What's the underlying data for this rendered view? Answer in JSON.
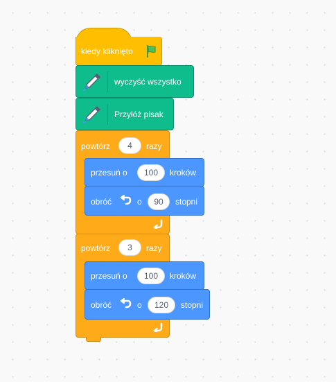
{
  "script": {
    "hat": {
      "label": "kiedy kliknięto",
      "icon": "green-flag-icon"
    },
    "clear_all": {
      "label": "wyczyść wszystko",
      "icon": "pen-icon"
    },
    "pen_down": {
      "label": "Przyłóż pisak",
      "icon": "pen-icon"
    },
    "repeat_1": {
      "label_before": "powtórz",
      "count": "4",
      "label_after": "razy",
      "move": {
        "label_before": "przesuń o",
        "value": "100",
        "label_after": "kroków"
      },
      "turn": {
        "label_before": "obróć",
        "icon": "rotate-left-icon",
        "label_mid": "o",
        "value": "90",
        "label_after": "stopni"
      },
      "loop_icon": "loop-arrow-icon"
    },
    "repeat_2": {
      "label_before": "powtórz",
      "count": "3",
      "label_after": "razy",
      "move": {
        "label_before": "przesuń o",
        "value": "100",
        "label_after": "kroków"
      },
      "turn": {
        "label_before": "obróć",
        "icon": "rotate-left-icon",
        "label_mid": "o",
        "value": "120",
        "label_after": "stopni"
      },
      "loop_icon": "loop-arrow-icon"
    }
  },
  "colors": {
    "events": "#ffbf00",
    "pen": "#0fbd8c",
    "control": "#ffab19",
    "motion": "#4c97ff",
    "canvas": "#f9f9f9"
  }
}
